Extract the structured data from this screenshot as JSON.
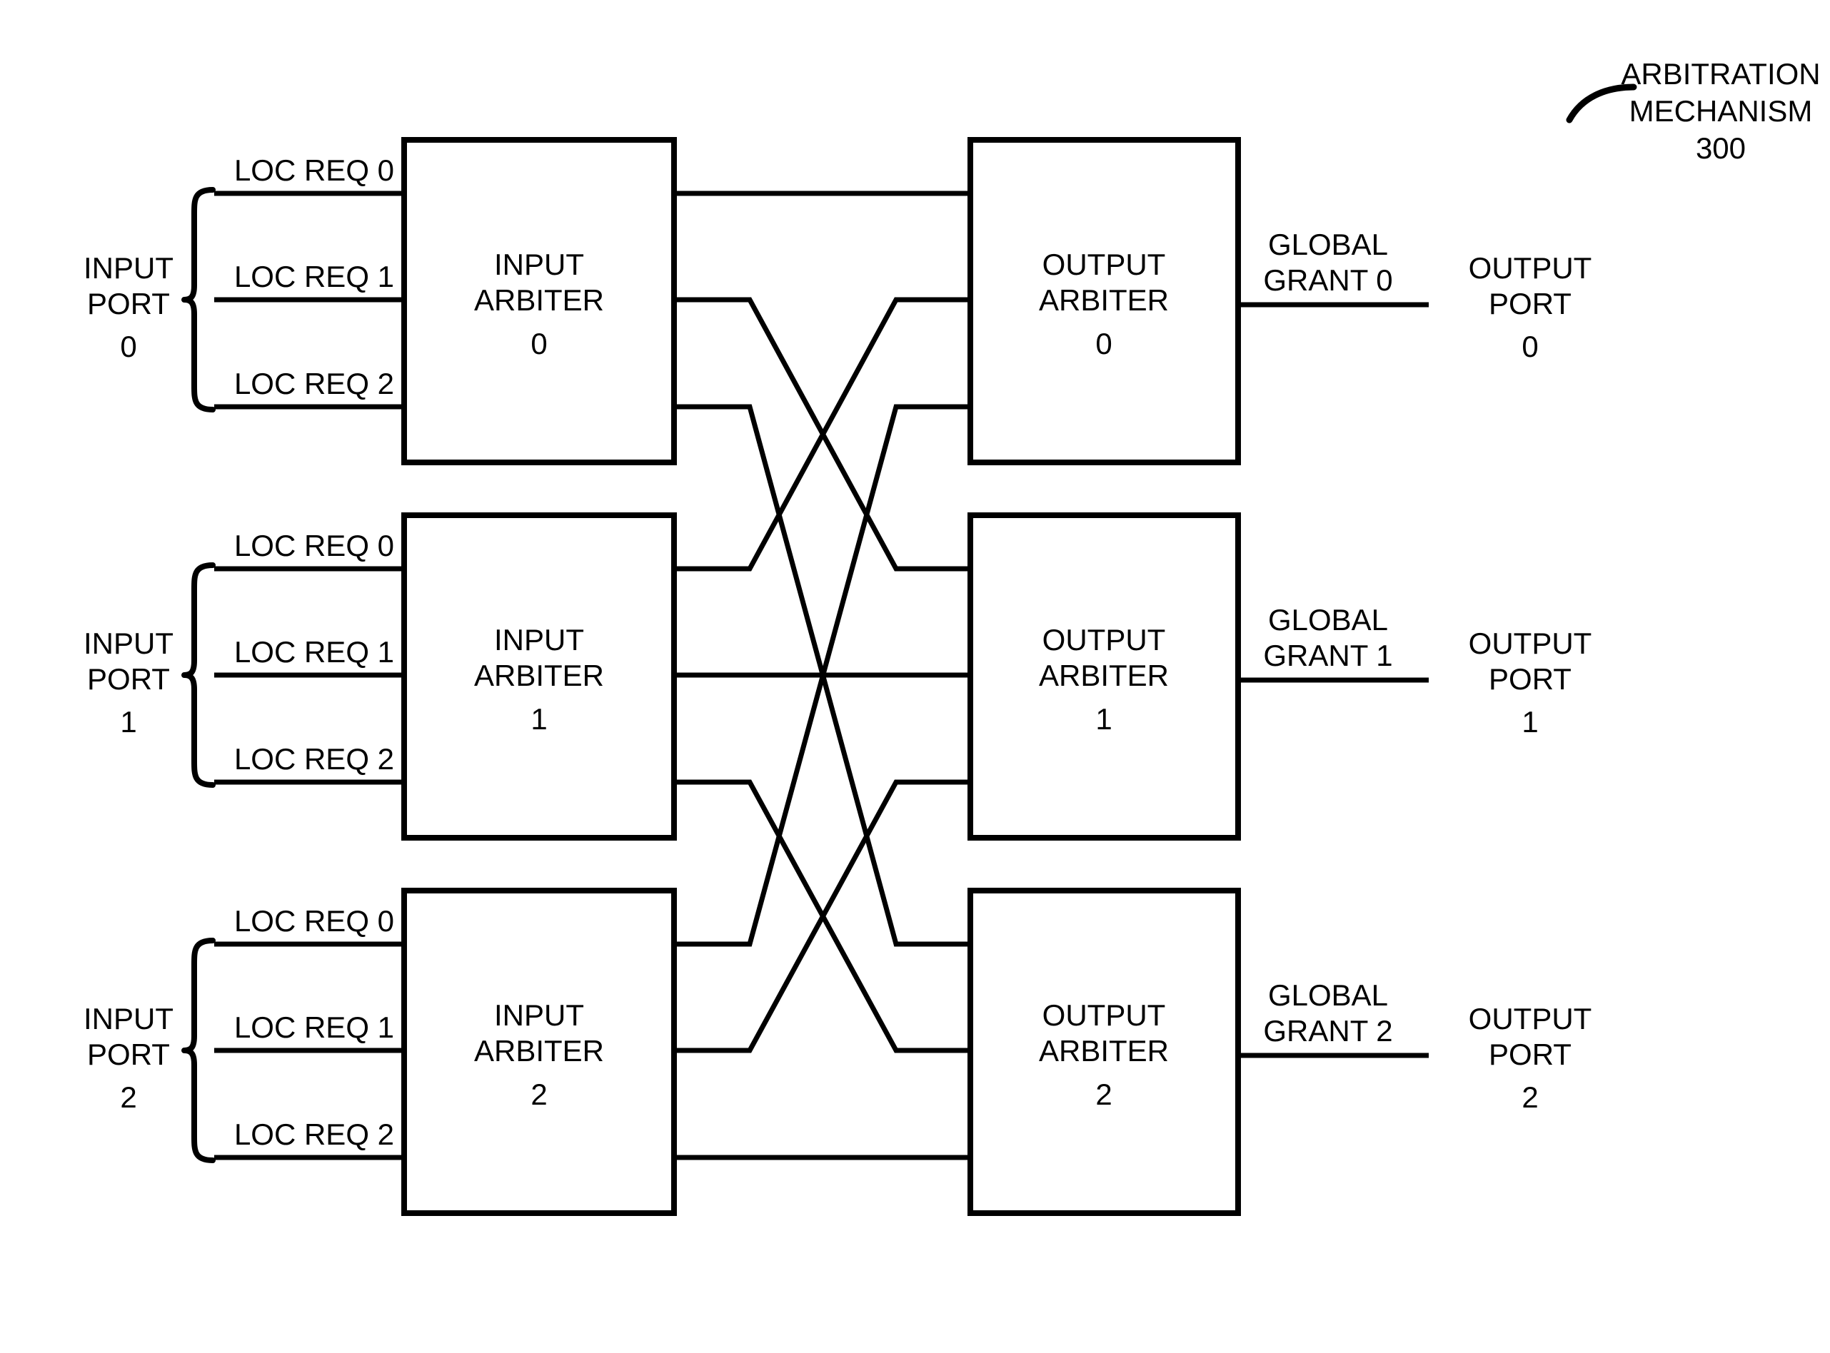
{
  "figure": {
    "title_lines": [
      "ARBITRATION",
      "MECHANISM",
      "300"
    ],
    "title_l1": "ARBITRATION",
    "title_l2": "MECHANISM",
    "title_l3": "300"
  },
  "input_ports": [
    {
      "label_l1": "INPUT",
      "label_l2": "PORT",
      "label_l3": "0",
      "requests": [
        "LOC REQ 0",
        "LOC REQ 1",
        "LOC REQ 2"
      ]
    },
    {
      "label_l1": "INPUT",
      "label_l2": "PORT",
      "label_l3": "1",
      "requests": [
        "LOC REQ 0",
        "LOC REQ 1",
        "LOC REQ 2"
      ]
    },
    {
      "label_l1": "INPUT",
      "label_l2": "PORT",
      "label_l3": "2",
      "requests": [
        "LOC REQ 0",
        "LOC REQ 1",
        "LOC REQ 2"
      ]
    }
  ],
  "input_arbiters": [
    {
      "l1": "INPUT",
      "l2": "ARBITER",
      "l3": "0"
    },
    {
      "l1": "INPUT",
      "l2": "ARBITER",
      "l3": "1"
    },
    {
      "l1": "INPUT",
      "l2": "ARBITER",
      "l3": "2"
    }
  ],
  "output_arbiters": [
    {
      "l1": "OUTPUT",
      "l2": "ARBITER",
      "l3": "0"
    },
    {
      "l1": "OUTPUT",
      "l2": "ARBITER",
      "l3": "1"
    },
    {
      "l1": "OUTPUT",
      "l2": "ARBITER",
      "l3": "2"
    }
  ],
  "grants": [
    {
      "l1": "GLOBAL",
      "l2": "GRANT 0"
    },
    {
      "l1": "GLOBAL",
      "l2": "GRANT 1"
    },
    {
      "l1": "GLOBAL",
      "l2": "GRANT 2"
    }
  ],
  "output_ports": [
    {
      "l1": "OUTPUT",
      "l2": "PORT",
      "l3": "0"
    },
    {
      "l1": "OUTPUT",
      "l2": "PORT",
      "l3": "1"
    },
    {
      "l1": "OUTPUT",
      "l2": "PORT",
      "l3": "2"
    }
  ],
  "colors": {
    "line": "#000000",
    "background": "#ffffff",
    "text": "#000000"
  },
  "chart_data": {
    "type": "diagram",
    "title": "ARBITRATION MECHANISM 300",
    "nodes": [
      "INPUT ARBITER 0",
      "INPUT ARBITER 1",
      "INPUT ARBITER 2",
      "OUTPUT ARBITER 0",
      "OUTPUT ARBITER 1",
      "OUTPUT ARBITER 2"
    ],
    "edges": [
      {
        "from": "INPUT ARBITER 0",
        "out_index": 0,
        "to": "OUTPUT ARBITER 0",
        "in_index": 0
      },
      {
        "from": "INPUT ARBITER 0",
        "out_index": 1,
        "to": "OUTPUT ARBITER 1",
        "in_index": 0
      },
      {
        "from": "INPUT ARBITER 0",
        "out_index": 2,
        "to": "OUTPUT ARBITER 2",
        "in_index": 0
      },
      {
        "from": "INPUT ARBITER 1",
        "out_index": 0,
        "to": "OUTPUT ARBITER 0",
        "in_index": 1
      },
      {
        "from": "INPUT ARBITER 1",
        "out_index": 1,
        "to": "OUTPUT ARBITER 1",
        "in_index": 1
      },
      {
        "from": "INPUT ARBITER 1",
        "out_index": 2,
        "to": "OUTPUT ARBITER 2",
        "in_index": 1
      },
      {
        "from": "INPUT ARBITER 2",
        "out_index": 0,
        "to": "OUTPUT ARBITER 0",
        "in_index": 2
      },
      {
        "from": "INPUT ARBITER 2",
        "out_index": 1,
        "to": "OUTPUT ARBITER 1",
        "in_index": 2
      },
      {
        "from": "INPUT ARBITER 2",
        "out_index": 2,
        "to": "OUTPUT ARBITER 2",
        "in_index": 2
      }
    ]
  }
}
